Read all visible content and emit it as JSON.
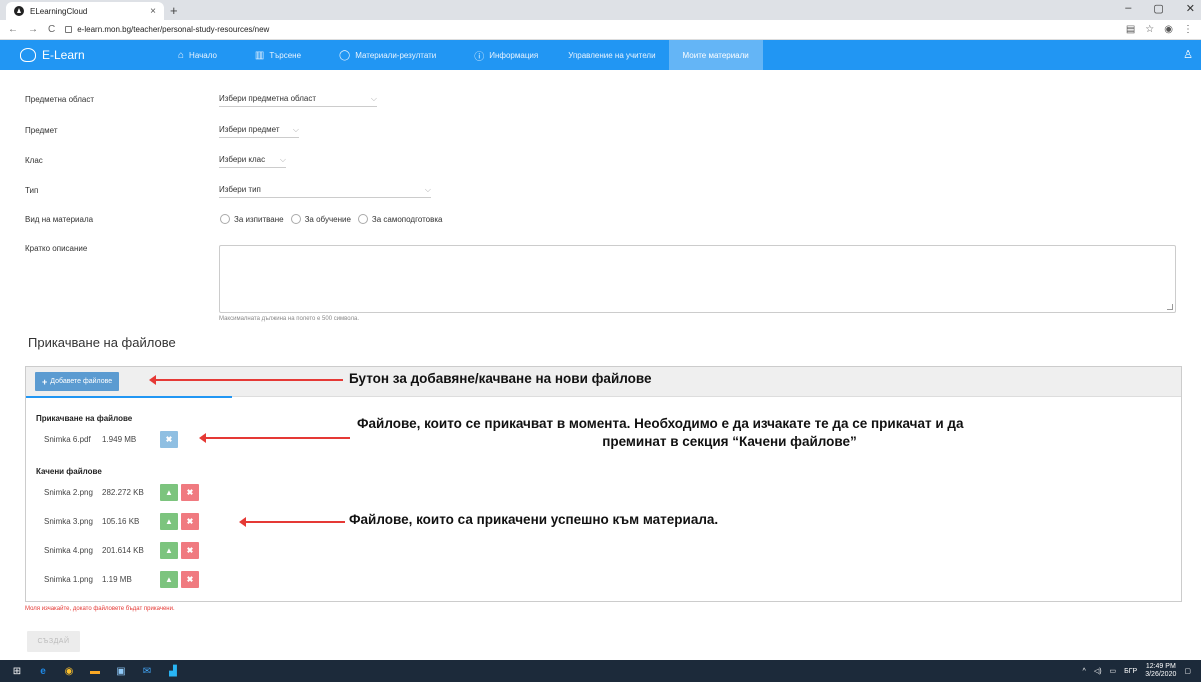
{
  "browser": {
    "tab_title": "ELearningCloud",
    "tab_close": "×",
    "new_tab": "+",
    "url": "e-learn.mon.bg/teacher/personal-study-resources/new",
    "window_controls": [
      "–",
      "▢",
      "✕"
    ]
  },
  "nav": {
    "brand": "E-Learn",
    "items": [
      {
        "label": "Начало",
        "icon": "home-icon",
        "glyph": "⌂"
      },
      {
        "label": "Търсене",
        "icon": "library-icon",
        "glyph": "▥"
      },
      {
        "label": "Материали-резултати",
        "icon": "search-icon",
        "glyph": "◯"
      },
      {
        "label": "Информация",
        "icon": "info-icon",
        "glyph": "ⓘ"
      },
      {
        "label": "Управление на учители",
        "icon": "",
        "glyph": ""
      },
      {
        "label": "Моите материали",
        "icon": "",
        "glyph": "",
        "active": true
      }
    ]
  },
  "form": {
    "subject_area_label": "Предметна област",
    "subject_area_value": "Избери предметна област",
    "subject_label": "Предмет",
    "subject_value": "Избери предмет",
    "class_label": "Клас",
    "class_value": "Избери клас",
    "type_label": "Тип",
    "type_value": "Избери тип",
    "material_kind_label": "Вид на материала",
    "material_kinds": [
      "За изпитване",
      "За обучение",
      "За самоподготовка"
    ],
    "description_label": "Кратко описание",
    "description_hint": "Максималната дължина на полето е 500 символа."
  },
  "upload": {
    "section_title": "Прикачване на файлове",
    "add_button": "Добавете файлове",
    "uploading_title": "Прикачване на файлове",
    "uploading_files": [
      {
        "name": "Snimka 6.pdf",
        "size": "1.949 MB"
      }
    ],
    "uploaded_title": "Качени файлове",
    "uploaded_files": [
      {
        "name": "Snimka 2.png",
        "size": "282.272 KB"
      },
      {
        "name": "Snimka 3.png",
        "size": "105.16 KB"
      },
      {
        "name": "Snimka 4.png",
        "size": "201.614 KB"
      },
      {
        "name": "Snimka 1.png",
        "size": "1.19 MB"
      }
    ],
    "wait_message": "Моля изчакайте, докато файловете бъдат прикачени.",
    "create_button": "СЪЗДАЙ"
  },
  "annotations": {
    "add_button_note": "Бутон за добавяне/качване на нови файлове",
    "uploading_note_line1": "Файлове, които се прикачват в момента. Необходимо е да изчакате те да се прикачат и да",
    "uploading_note_line2": "преминат в секция “Качени файлове”",
    "uploaded_note": "Файлове, които са прикачени успешно към материала."
  },
  "taskbar": {
    "lang": "БГР",
    "time": "12:49 PM",
    "date": "3/26/2020"
  },
  "colors": {
    "nav_bg": "#2196f3",
    "active_nav": "#64b5f6",
    "download_btn": "#7cc47e",
    "delete_btn": "#f07a80",
    "annotation_arrow": "#e53935"
  }
}
